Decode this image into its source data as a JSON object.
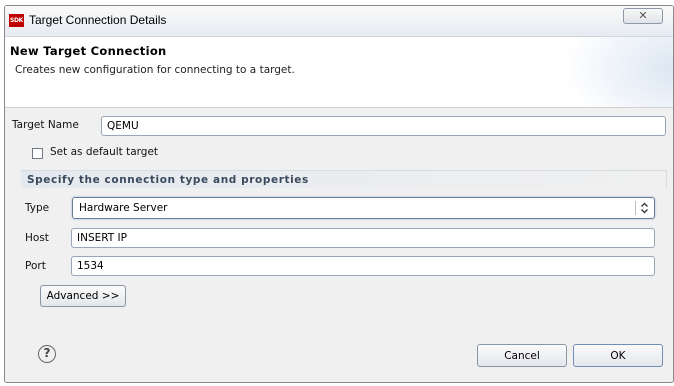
{
  "window": {
    "title": "Target Connection Details",
    "app_icon_text": "SDK",
    "close_glyph": "✕"
  },
  "banner": {
    "title": "New Target Connection",
    "description": "Creates new configuration for connecting to a target."
  },
  "form": {
    "target_name_label": "Target Name",
    "target_name_value": "QEMU",
    "default_checkbox_label": "Set as default target",
    "default_checked": false,
    "group_title": "Specify the connection type and properties",
    "type_label": "Type",
    "type_value": "Hardware Server",
    "host_label": "Host",
    "host_value": "INSERT IP",
    "port_label": "Port",
    "port_value": "1534",
    "advanced_button": "Advanced >>"
  },
  "footer": {
    "help_glyph": "?",
    "cancel_button": "Cancel",
    "ok_button": "OK"
  },
  "colors": {
    "app_icon": "#c00000",
    "group_title": "#3b4a5c",
    "focus_border": "#6a7f98"
  }
}
